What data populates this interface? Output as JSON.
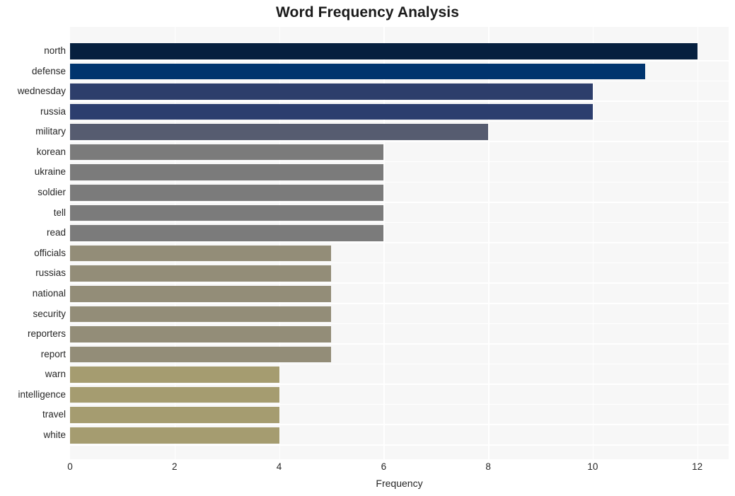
{
  "chart_data": {
    "type": "bar",
    "orientation": "horizontal",
    "title": "Word Frequency Analysis",
    "xlabel": "Frequency",
    "ylabel": "",
    "categories": [
      "north",
      "defense",
      "wednesday",
      "russia",
      "military",
      "korean",
      "ukraine",
      "soldier",
      "tell",
      "read",
      "officials",
      "russias",
      "national",
      "security",
      "reporters",
      "report",
      "warn",
      "intelligence",
      "travel",
      "white"
    ],
    "values": [
      12,
      11,
      10,
      10,
      8,
      6,
      6,
      6,
      6,
      6,
      5,
      5,
      5,
      5,
      5,
      5,
      4,
      4,
      4,
      4
    ],
    "bar_colors": [
      "#06203F",
      "#00346E",
      "#2D3E6B",
      "#2C3E6E",
      "#565C70",
      "#7B7B7B",
      "#7B7B7B",
      "#7B7B7B",
      "#7B7B7B",
      "#7B7B7B",
      "#938D78",
      "#938D78",
      "#938D78",
      "#938D78",
      "#938D78",
      "#938D78",
      "#A59C70",
      "#A59C70",
      "#A59C70",
      "#A59C70"
    ],
    "xlim": [
      0,
      12.6
    ],
    "xticks": [
      0,
      2,
      4,
      6,
      8,
      10,
      12
    ],
    "xtick_labels": [
      "0",
      "2",
      "4",
      "6",
      "8",
      "10",
      "12"
    ],
    "grid": true,
    "grid_color": "#ffffff",
    "plot_background": "#f7f7f7",
    "figure_background": "#ffffff",
    "legend": null
  }
}
